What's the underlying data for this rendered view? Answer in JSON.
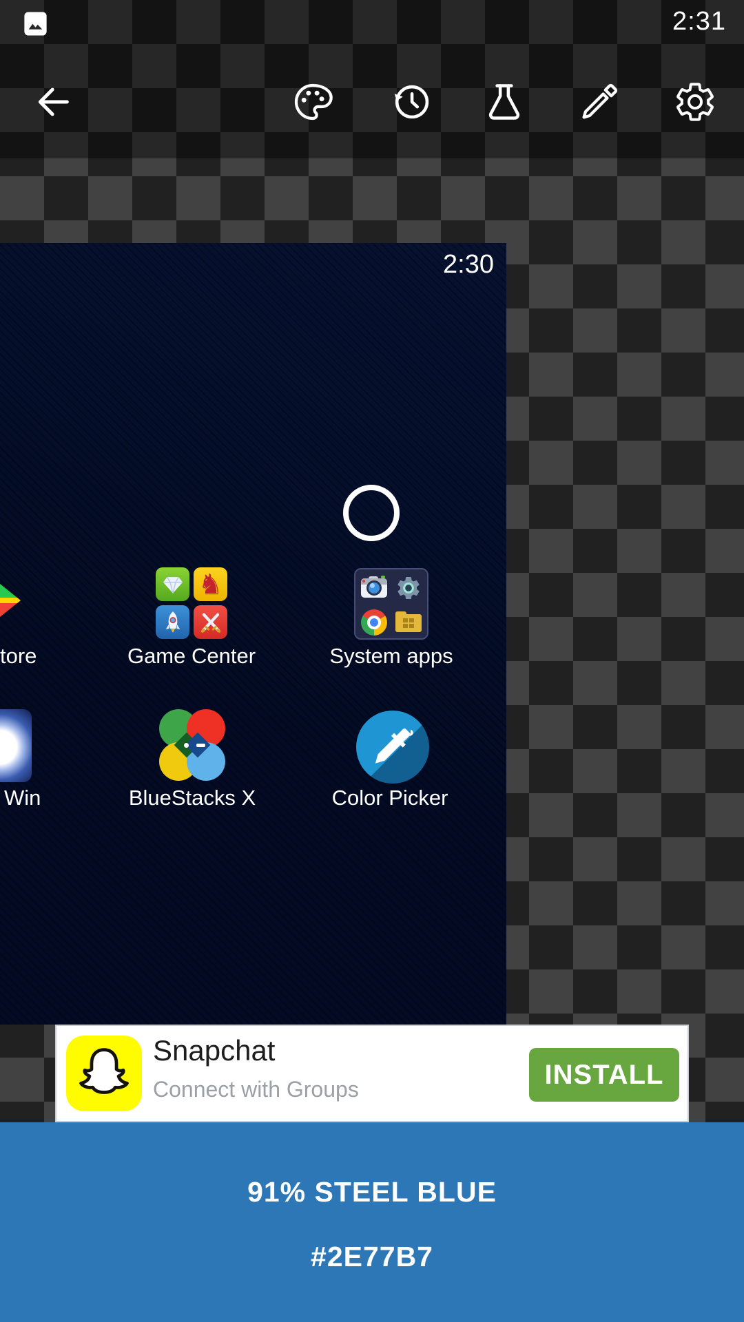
{
  "status_bar": {
    "time": "2:31"
  },
  "toolbar": {
    "buttons": [
      "back",
      "palette",
      "history",
      "test-flask",
      "eyedropper",
      "settings"
    ]
  },
  "screenshot": {
    "status_time": "2:30",
    "apps": {
      "play_store": {
        "label": "tore"
      },
      "game_center": {
        "label": "Game Center"
      },
      "system_apps": {
        "label": "System apps"
      },
      "win": {
        "label": "Win"
      },
      "bluestacks": {
        "label": "BlueStacks X"
      },
      "color_picker": {
        "label": "Color Picker"
      }
    },
    "glyphs": {
      "knight": "♞"
    }
  },
  "ad": {
    "app_name": "Snapchat",
    "tagline": "Connect with Groups",
    "cta": "INSTALL"
  },
  "result": {
    "match_text": "91% STEEL BLUE",
    "hex": "#2E77B7"
  },
  "colors": {
    "picked_color": "#2E77B7",
    "install_green": "#68a63f",
    "snapchat_yellow": "#FFFC00",
    "checker_light": "#424242",
    "checker_dark": "#212121",
    "screenshot_navy": "#040e2a"
  }
}
